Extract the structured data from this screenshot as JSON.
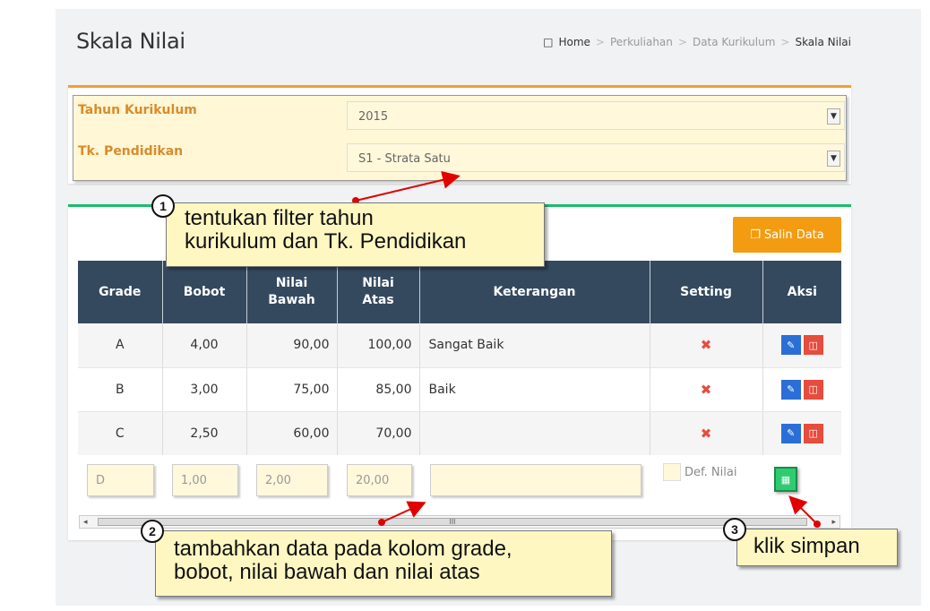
{
  "page": {
    "title": "Skala Nilai",
    "breadcrumb": [
      "Home",
      "Perkuliahan",
      "Data Kurikulum",
      "Skala Nilai"
    ],
    "breadcrumb_sep": ">"
  },
  "filter": {
    "tahun_label": "Tahun Kurikulum",
    "tahun_value": "2015",
    "tk_label": "Tk. Pendidikan",
    "tk_value": "S1 - Strata Satu"
  },
  "toolbar": {
    "salin_label": "Salin Data"
  },
  "table": {
    "headers": {
      "grade": "Grade",
      "bobot": "Bobot",
      "nilai_bawah_1": "Nilai",
      "nilai_bawah_2": "Bawah",
      "nilai_atas_1": "Nilai",
      "nilai_atas_2": "Atas",
      "keterangan": "Keterangan",
      "setting": "Setting",
      "aksi": "Aksi"
    },
    "rows": [
      {
        "grade": "A",
        "bobot": "4,00",
        "bawah": "90,00",
        "atas": "100,00",
        "ket": "Sangat Baik",
        "setting": "✖"
      },
      {
        "grade": "B",
        "bobot": "3,00",
        "bawah": "75,00",
        "atas": "85,00",
        "ket": "Baik",
        "setting": "✖"
      },
      {
        "grade": "C",
        "bobot": "2,50",
        "bawah": "60,00",
        "atas": "70,00",
        "ket": "",
        "setting": "✖"
      }
    ],
    "new_row": {
      "grade": "D",
      "bobot": "1,00",
      "bawah": "2,00",
      "atas": "20,00",
      "keterangan": "",
      "default_label": "Def. Nilai"
    }
  },
  "scrollbar": {
    "thumb_grip": "III",
    "left_arrow": "◂",
    "right_arrow": "▸"
  },
  "callouts": {
    "c1_num": "1",
    "c1_line1": "tentukan filter tahun",
    "c1_line2": "kurikulum dan Tk. Pendidikan",
    "c2_num": "2",
    "c2_line1": "tambahkan data pada kolom grade,",
    "c2_line2": "bobot, nilai bawah dan nilai atas",
    "c3_num": "3",
    "c3_text": "klik simpan"
  },
  "icons": {
    "breadcrumb": "book-icon",
    "salin": "copy-icon",
    "edit": "pencil-icon",
    "delete": "trash-icon",
    "save": "floppy-disk-icon",
    "setting": "x-mark-icon"
  },
  "colors": {
    "orange_accent": "#f0a030",
    "green_accent": "#1bbc6c",
    "header_bg": "#34495e",
    "salin_button": "#f39c12",
    "edit_button": "#2b6fd6",
    "delete_button": "#e74c3c",
    "save_button": "#2ecc71",
    "callout_bg": "#fff7c2",
    "arrow_red": "#e00000"
  }
}
